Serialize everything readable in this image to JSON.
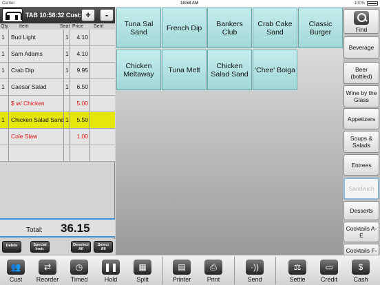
{
  "status_bar": {
    "carrier": "Carrier",
    "time": "10:58 AM",
    "battery": "100%"
  },
  "tab": {
    "title": "TAB 10:58:32  Cust:",
    "plus_label": "+",
    "minus_label": "-"
  },
  "columns": {
    "qty": "Qty",
    "item": "Item",
    "seat": "Seat",
    "price": "Price",
    "sent": "Sent"
  },
  "order_rows": [
    {
      "qty": "1",
      "item": "Bud Light",
      "seat": "1",
      "price": "4.10",
      "sent": "",
      "style": "normal"
    },
    {
      "qty": "1",
      "item": "Sam Adams",
      "seat": "1",
      "price": "4.10",
      "sent": "",
      "style": "normal"
    },
    {
      "qty": "1",
      "item": "Crab Dip",
      "seat": "1",
      "price": "9.95",
      "sent": "",
      "style": "normal"
    },
    {
      "qty": "1",
      "item": "Caesar Salad",
      "seat": "1",
      "price": "6.50",
      "sent": "",
      "style": "normal"
    },
    {
      "qty": "",
      "item": "$ w/ Chicken",
      "seat": "",
      "price": "5.00",
      "sent": "",
      "style": "modifier"
    },
    {
      "qty": "1",
      "item": "Chicken Salad Sand",
      "seat": "1",
      "price": "5.50",
      "sent": "",
      "style": "selected"
    },
    {
      "qty": "",
      "item": "Cole Slaw",
      "seat": "",
      "price": "1.00",
      "sent": "",
      "style": "modifier"
    },
    {
      "qty": "",
      "item": "",
      "seat": "",
      "price": "",
      "sent": "",
      "style": "normal"
    }
  ],
  "total": {
    "label": "Total:",
    "value": "36.15"
  },
  "small_buttons": {
    "delete": "Delete",
    "special_1": "Special",
    "special_2": "Instr.",
    "deselect_1": "Deselect",
    "deselect_2": "All",
    "select_1": "Select",
    "select_2": "All"
  },
  "menu_items": [
    {
      "label": "Tuna Sal Sand"
    },
    {
      "label": "French Dip"
    },
    {
      "label": "Bankers Club"
    },
    {
      "label": "Crab Cake Sand"
    },
    {
      "label": "Classic Burger"
    },
    {
      "label": "Chicken Meltaway"
    },
    {
      "label": "Tuna Melt"
    },
    {
      "label": "Chicken Salad Sand"
    },
    {
      "label": "'Chee' Boiga"
    }
  ],
  "categories": [
    {
      "label": "Find",
      "icon": "search-icon"
    },
    {
      "label": "Beverage"
    },
    {
      "label": "Beer (bottled)"
    },
    {
      "label": "Wine by the Glass"
    },
    {
      "label": "Appetizers"
    },
    {
      "label": "Soups & Salads"
    },
    {
      "label": "Entrees"
    },
    {
      "label": "Sandwich",
      "active": true
    },
    {
      "label": "Desserts"
    },
    {
      "label": "Cocktails A-E"
    },
    {
      "label": "Cocktails F-"
    }
  ],
  "toolbar": [
    {
      "label": "Cust",
      "icon": "people-icon",
      "glyph": "👥"
    },
    {
      "label": "Reorder",
      "icon": "reorder-icon",
      "glyph": "⇄"
    },
    {
      "label": "Timed",
      "icon": "clock-icon",
      "glyph": "◷"
    },
    {
      "label": "Hold",
      "icon": "pause-icon",
      "glyph": "❚❚"
    },
    {
      "label": "Split",
      "icon": "split-icon",
      "glyph": "▦"
    },
    {
      "label": "Printer",
      "icon": "printer-select-icon",
      "glyph": "▤"
    },
    {
      "label": "Print",
      "icon": "printer-icon",
      "glyph": "⎙"
    },
    {
      "label": "Send",
      "icon": "send-icon",
      "glyph": "·))"
    },
    {
      "label": "Settle",
      "icon": "scale-icon",
      "glyph": "⚖"
    },
    {
      "label": "Credit",
      "icon": "credit-card-icon",
      "glyph": "▭"
    },
    {
      "label": "Cash",
      "icon": "dollar-icon",
      "glyph": "$"
    }
  ],
  "colors": {
    "item_teal": "#b4e2e2",
    "selected_row": "#e6e60a",
    "modifier_red": "#e01010",
    "accent_blue": "#3a8fd8"
  }
}
